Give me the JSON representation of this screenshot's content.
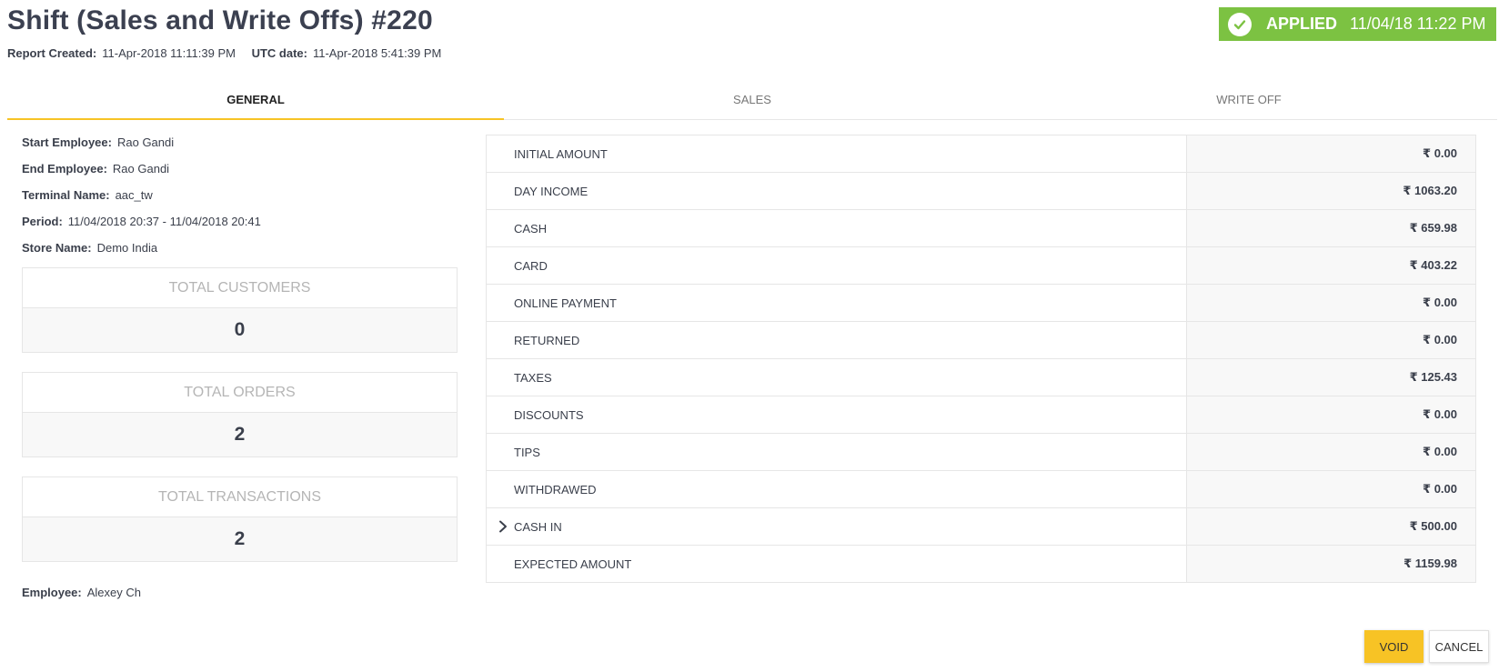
{
  "header": {
    "title": "Shift (Sales and Write Offs) #220",
    "report_created_label": "Report Created:",
    "report_created_value": "11-Apr-2018 11:11:39 PM",
    "utc_label": "UTC date:",
    "utc_value": "11-Apr-2018 5:41:39 PM"
  },
  "status": {
    "text": "APPLIED",
    "date": "11/04/18 11:22 PM",
    "color": "#7cc242",
    "icon": "check-circle-icon"
  },
  "tabs": [
    {
      "label": "GENERAL",
      "active": true
    },
    {
      "label": "SALES",
      "active": false
    },
    {
      "label": "WRITE OFF",
      "active": false
    }
  ],
  "info": [
    {
      "label": "Start Employee:",
      "value": "Rao Gandi"
    },
    {
      "label": "End Employee:",
      "value": "Rao Gandi"
    },
    {
      "label": "Terminal Name:",
      "value": "aac_tw"
    },
    {
      "label": "Period:",
      "value": "11/04/2018 20:37 - 11/04/2018 20:41"
    },
    {
      "label": "Store Name:",
      "value": "Demo India"
    }
  ],
  "stats": [
    {
      "label": "TOTAL CUSTOMERS",
      "value": "0"
    },
    {
      "label": "TOTAL ORDERS",
      "value": "2"
    },
    {
      "label": "TOTAL TRANSACTIONS",
      "value": "2"
    }
  ],
  "employee": {
    "label": "Employee:",
    "value": "Alexey Ch"
  },
  "summary": [
    {
      "label": "INITIAL AMOUNT",
      "amount": "₹ 0.00"
    },
    {
      "label": "DAY INCOME",
      "amount": "₹ 1063.20"
    },
    {
      "label": "CASH",
      "amount": "₹ 659.98"
    },
    {
      "label": "CARD",
      "amount": "₹ 403.22"
    },
    {
      "label": "ONLINE PAYMENT",
      "amount": "₹ 0.00"
    },
    {
      "label": "RETURNED",
      "amount": "₹ 0.00"
    },
    {
      "label": "TAXES",
      "amount": "₹ 125.43"
    },
    {
      "label": "DISCOUNTS",
      "amount": "₹ 0.00"
    },
    {
      "label": "TIPS",
      "amount": "₹ 0.00"
    },
    {
      "label": "WITHDRAWED",
      "amount": "₹ 0.00"
    },
    {
      "label": "CASH IN",
      "amount": "₹ 500.00",
      "expandable": true
    },
    {
      "label": "EXPECTED AMOUNT",
      "amount": "₹ 1159.98"
    }
  ],
  "actions": {
    "void_label": "VOID",
    "cancel_label": "CANCEL",
    "accent_color": "#f7c325"
  }
}
